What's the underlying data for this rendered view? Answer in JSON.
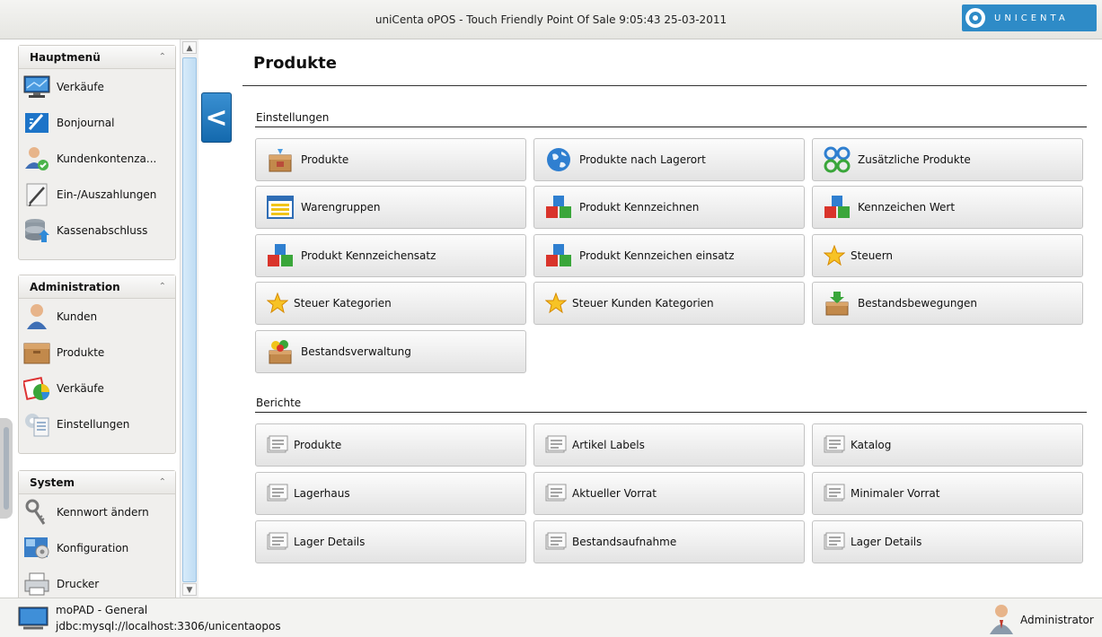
{
  "window": {
    "title": "uniCenta oPOS - Touch Friendly Point Of Sale  9:05:43  25-03-2011",
    "logo_text": "UNICENTA"
  },
  "sidebar": {
    "main_menu": {
      "header": "Hauptmenü",
      "items": [
        {
          "label": "Verkäufe",
          "icon": "monitor-icon"
        },
        {
          "label": "Bonjournal",
          "icon": "journal-icon"
        },
        {
          "label": "Kundenkontenza...",
          "icon": "customer-account-icon"
        },
        {
          "label": "Ein-/Auszahlungen",
          "icon": "pen-icon"
        },
        {
          "label": "Kassenabschluss",
          "icon": "database-icon"
        }
      ]
    },
    "administration": {
      "header": "Administration",
      "items": [
        {
          "label": "Kunden",
          "icon": "customer-icon"
        },
        {
          "label": "Produkte",
          "icon": "box-icon"
        },
        {
          "label": "Verkäufe",
          "icon": "sales-chart-icon"
        },
        {
          "label": "Einstellungen",
          "icon": "settings-doc-icon"
        }
      ]
    },
    "system": {
      "header": "System",
      "items": [
        {
          "label": "Kennwort ändern",
          "icon": "keys-icon"
        },
        {
          "label": "Konfiguration",
          "icon": "config-icon"
        },
        {
          "label": "Drucker",
          "icon": "printer-icon"
        }
      ]
    }
  },
  "main": {
    "title": "Produkte",
    "settings_section": "Einstellungen",
    "settings_buttons": [
      {
        "label": "Produkte",
        "icon": "product-box-icon"
      },
      {
        "label": "Produkte nach Lagerort",
        "icon": "globe-icon"
      },
      {
        "label": "Zusätzliche Produkte",
        "icon": "auxiliary-icon"
      },
      {
        "label": "Warengruppen",
        "icon": "category-list-icon"
      },
      {
        "label": "Produkt Kennzeichnen",
        "icon": "attributes-cubes-icon"
      },
      {
        "label": "Kennzeichen Wert",
        "icon": "attributes-cubes-icon"
      },
      {
        "label": "Produkt Kennzeichensatz",
        "icon": "attributes-cubes-icon"
      },
      {
        "label": "Produkt Kennzeichen einsatz",
        "icon": "attributes-cubes-icon"
      },
      {
        "label": "Steuern",
        "icon": "star-icon"
      },
      {
        "label": "Steuer Kategorien",
        "icon": "star-icon"
      },
      {
        "label": "Steuer Kunden Kategorien",
        "icon": "star-icon"
      },
      {
        "label": "Bestandsbewegungen",
        "icon": "stock-move-icon"
      },
      {
        "label": "Bestandsverwaltung",
        "icon": "stock-manage-icon"
      }
    ],
    "reports_section": "Berichte",
    "report_buttons": [
      {
        "label": "Produkte",
        "icon": "report-icon"
      },
      {
        "label": "Artikel Labels",
        "icon": "report-icon"
      },
      {
        "label": "Katalog",
        "icon": "report-icon"
      },
      {
        "label": "Lagerhaus",
        "icon": "report-icon"
      },
      {
        "label": "Aktueller Vorrat",
        "icon": "report-icon"
      },
      {
        "label": "Minimaler Vorrat",
        "icon": "report-icon"
      },
      {
        "label": "Lager Details",
        "icon": "report-icon"
      },
      {
        "label": "Bestandsaufnahme",
        "icon": "report-icon"
      },
      {
        "label": "Lager Details",
        "icon": "report-icon"
      }
    ]
  },
  "status": {
    "host": "moPAD - General",
    "db_url": "jdbc:mysql://localhost:3306/unicentaopos",
    "user": "Administrator"
  },
  "colors": {
    "accent_blue": "#1c75bc",
    "star_yellow": "#f7c325",
    "cube_red": "#d9342b",
    "cube_green": "#3aa63a"
  }
}
